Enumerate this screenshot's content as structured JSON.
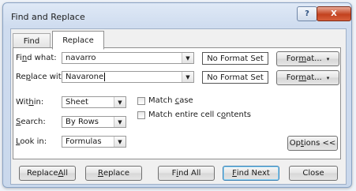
{
  "window": {
    "title": "Find and Replace",
    "help_label": "?",
    "close_label": "X"
  },
  "tabs": [
    {
      "label": "Find"
    },
    {
      "label": "Replace"
    }
  ],
  "find": {
    "label_pre": "Fi",
    "label_key": "n",
    "label_post": "d what:",
    "value": "navarro",
    "format_status": "No Format Set"
  },
  "replace": {
    "label_pre": "Re",
    "label_key": "p",
    "label_post": "lace with:",
    "value": "Navarone",
    "format_status": "No Format Set"
  },
  "format_button": {
    "pre": "For",
    "key": "m",
    "post": "at...",
    "arrow": "▾"
  },
  "within": {
    "label_pre": "Wit",
    "label_key": "h",
    "label_post": "in:",
    "value": "Sheet"
  },
  "search": {
    "label_key": "S",
    "label_post": "earch:",
    "value": "By Rows"
  },
  "lookin": {
    "label_key": "L",
    "label_post": "ook in:",
    "value": "Formulas"
  },
  "match_case": {
    "pre": "Match ",
    "key": "c",
    "post": "ase",
    "checked": false
  },
  "match_entire": {
    "pre": "Match entire cell c",
    "key": "o",
    "post": "ntents",
    "checked": false
  },
  "options_button": {
    "pre": "Op",
    "key": "t",
    "post": "ions <<"
  },
  "buttons": {
    "replace_all": {
      "pre": "Replace ",
      "key": "A",
      "post": "ll"
    },
    "replace": {
      "pre": "",
      "key": "R",
      "post": "eplace"
    },
    "find_all": {
      "pre": "F",
      "key": "i",
      "post": "nd All"
    },
    "find_next": {
      "pre": "",
      "key": "F",
      "post": "ind Next"
    },
    "close": {
      "label": "Close"
    }
  },
  "colors": {
    "title_bar": "#cfdcef",
    "close_button": "#c3421f",
    "default_button_border": "#3c7fb1"
  }
}
